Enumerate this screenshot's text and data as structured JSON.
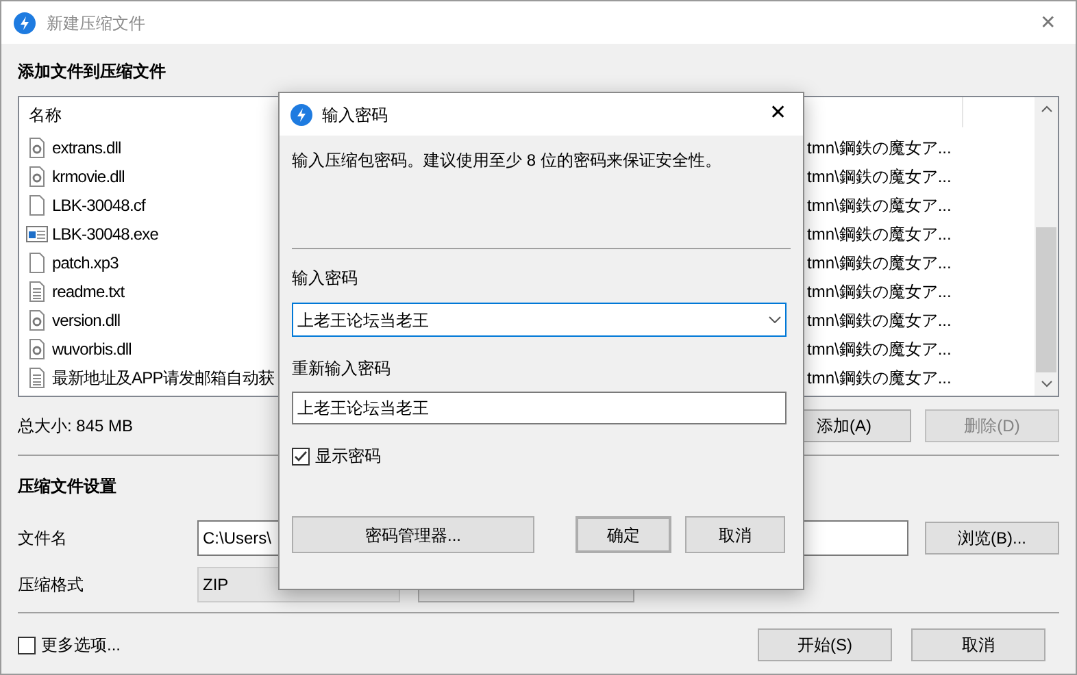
{
  "window": {
    "title": "新建压缩文件",
    "close": "✕"
  },
  "add_section": {
    "title": "添加文件到压缩文件"
  },
  "file_list": {
    "columns": [
      "名称"
    ],
    "rows": [
      {
        "kind": "dll",
        "name": "extrans.dll",
        "path": "tmn\\鋼鉄の魔女ア..."
      },
      {
        "kind": "dll",
        "name": "krmovie.dll",
        "path": "tmn\\鋼鉄の魔女ア..."
      },
      {
        "kind": "file",
        "name": "LBK-30048.cf",
        "path": "tmn\\鋼鉄の魔女ア..."
      },
      {
        "kind": "exe",
        "name": "LBK-30048.exe",
        "path": "tmn\\鋼鉄の魔女ア..."
      },
      {
        "kind": "file",
        "name": "patch.xp3",
        "path": "tmn\\鋼鉄の魔女ア..."
      },
      {
        "kind": "text",
        "name": "readme.txt",
        "path": "tmn\\鋼鉄の魔女ア..."
      },
      {
        "kind": "dll",
        "name": "version.dll",
        "path": "tmn\\鋼鉄の魔女ア..."
      },
      {
        "kind": "dll",
        "name": "wuvorbis.dll",
        "path": "tmn\\鋼鉄の魔女ア..."
      },
      {
        "kind": "text",
        "name": "最新地址及APP请发邮箱自动获",
        "path": "tmn\\鋼鉄の魔女ア..."
      }
    ]
  },
  "total_size": "总大小: 845 MB",
  "list_buttons": [
    {
      "label": "添加(A)",
      "disabled": false
    },
    {
      "label": "删除(D)",
      "disabled": true
    }
  ],
  "settings_section": {
    "title": "压缩文件设置"
  },
  "filename": {
    "label": "文件名",
    "value": "C:\\Users\\",
    "button": "浏览(B)..."
  },
  "format": {
    "label": "压缩格式",
    "value": "ZIP"
  },
  "more_options": {
    "label": "更多选项...",
    "checked": false
  },
  "bottom_buttons": [
    "开始(S)",
    "取消"
  ],
  "dialog": {
    "title": "输入密码",
    "close": "✕",
    "description": "输入压缩包密码。建议使用至少 8 位的密码来保证安全性。",
    "password_label": "输入密码",
    "password_value": "上老王论坛当老王",
    "confirm_label": "重新输入密码",
    "confirm_value": "上老王论坛当老王",
    "show_password": {
      "label": "显示密码",
      "checked": true
    },
    "buttons": [
      {
        "label": "密码管理器...",
        "default": false
      },
      {
        "label": "确定",
        "default": true
      },
      {
        "label": "取消",
        "default": false
      }
    ]
  }
}
